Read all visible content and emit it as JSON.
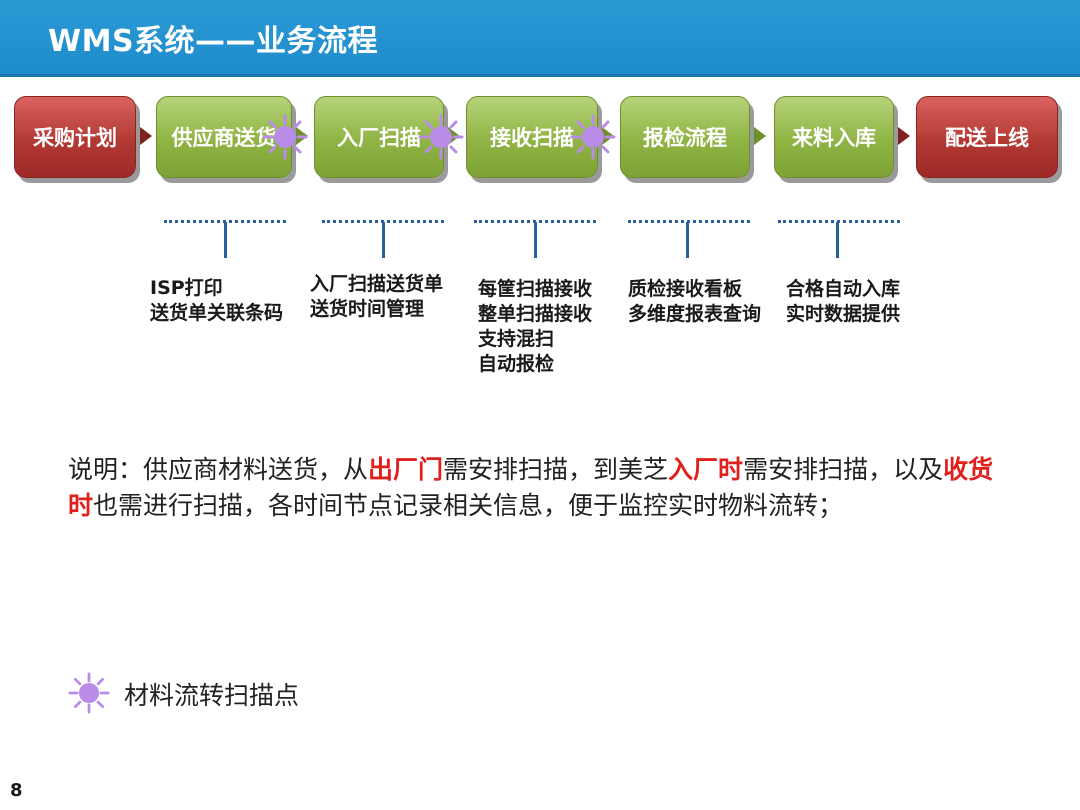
{
  "header": {
    "title": "WMS系统——业务流程"
  },
  "flow": [
    {
      "label": "采购计划",
      "color": "#b33934"
    },
    {
      "label": "供应商送货",
      "color": "#8fb444"
    },
    {
      "label": "入厂扫描",
      "color": "#8fb444"
    },
    {
      "label": "接收扫描",
      "color": "#8fb444"
    },
    {
      "label": "报检流程",
      "color": "#8fb444"
    },
    {
      "label": "来料入库",
      "color": "#8fb444"
    },
    {
      "label": "配送上线",
      "color": "#b33934"
    }
  ],
  "details": [
    {
      "lines": [
        "ISP打印",
        "送货单关联条码"
      ]
    },
    {
      "lines": [
        "入厂扫描送货单",
        "送货时间管理"
      ]
    },
    {
      "lines": [
        "每筐扫描接收",
        "整单扫描接收",
        "支持混扫",
        "自动报检"
      ]
    },
    {
      "lines": [
        "质检接收看板",
        "多维度报表查询"
      ]
    },
    {
      "lines": [
        "合格自动入库",
        "实时数据提供"
      ]
    }
  ],
  "note": {
    "p1": "说明：供应商材料送货，从",
    "h1": "出厂门",
    "p2": "需安排扫描，到美芝",
    "h2": "入厂时",
    "p3": "需安排扫描，以及",
    "h3": "收货时",
    "p4": "也需进行扫描，各时间节点记录相关信息，便于监控实时物料流转；"
  },
  "legend": {
    "icon": "scan-point-icon",
    "label": "材料流转扫描点"
  },
  "page_number": "8",
  "colors": {
    "header": "#1f8ccc",
    "highlight": "#e0201c",
    "scan_point": "#b98ce8"
  }
}
